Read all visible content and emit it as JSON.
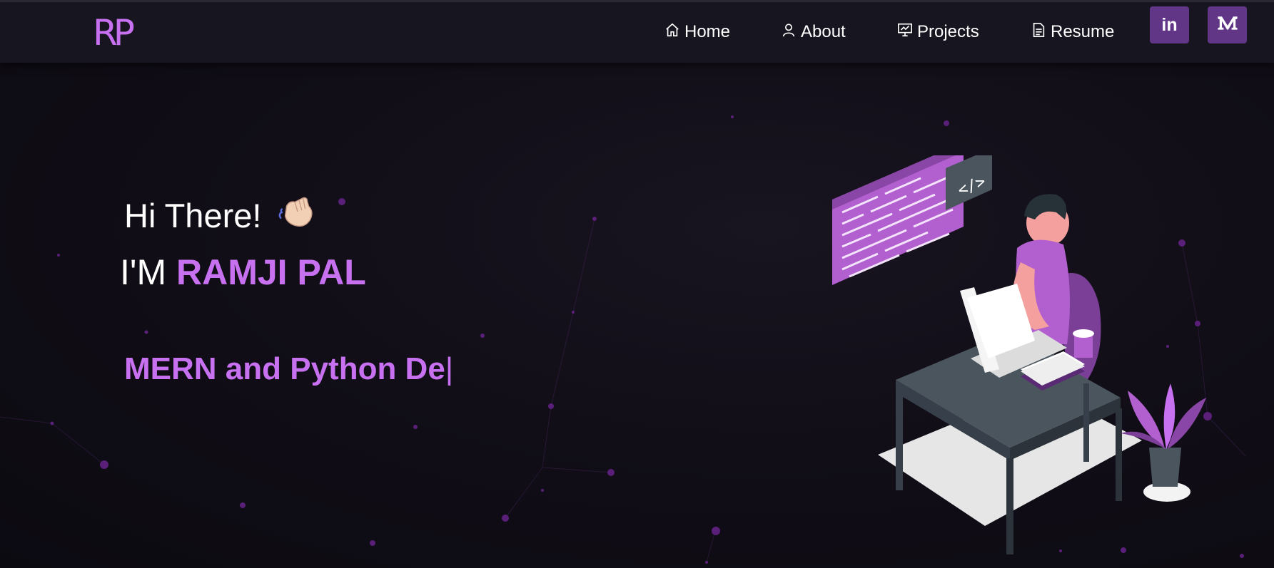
{
  "navbar": {
    "logo": "RP",
    "items": [
      {
        "label": "Home",
        "icon": "home-icon"
      },
      {
        "label": "About",
        "icon": "user-icon"
      },
      {
        "label": "Projects",
        "icon": "presentation-icon"
      },
      {
        "label": "Resume",
        "icon": "document-icon"
      }
    ],
    "social": [
      {
        "label": "in",
        "name": "linkedin"
      },
      {
        "label": "M",
        "name": "medium"
      }
    ]
  },
  "hero": {
    "greeting": "Hi There!",
    "greeting_emoji": "waving-hand-icon",
    "intro_prefix": "I'M",
    "name": "RAMJI PAL",
    "typewriter_text": "MERN and Python De",
    "cursor": "|"
  },
  "colors": {
    "accent": "#c770f0",
    "navbar_bg": "#17151f",
    "social_bg": "#623686",
    "page_bg": "#100d16"
  }
}
